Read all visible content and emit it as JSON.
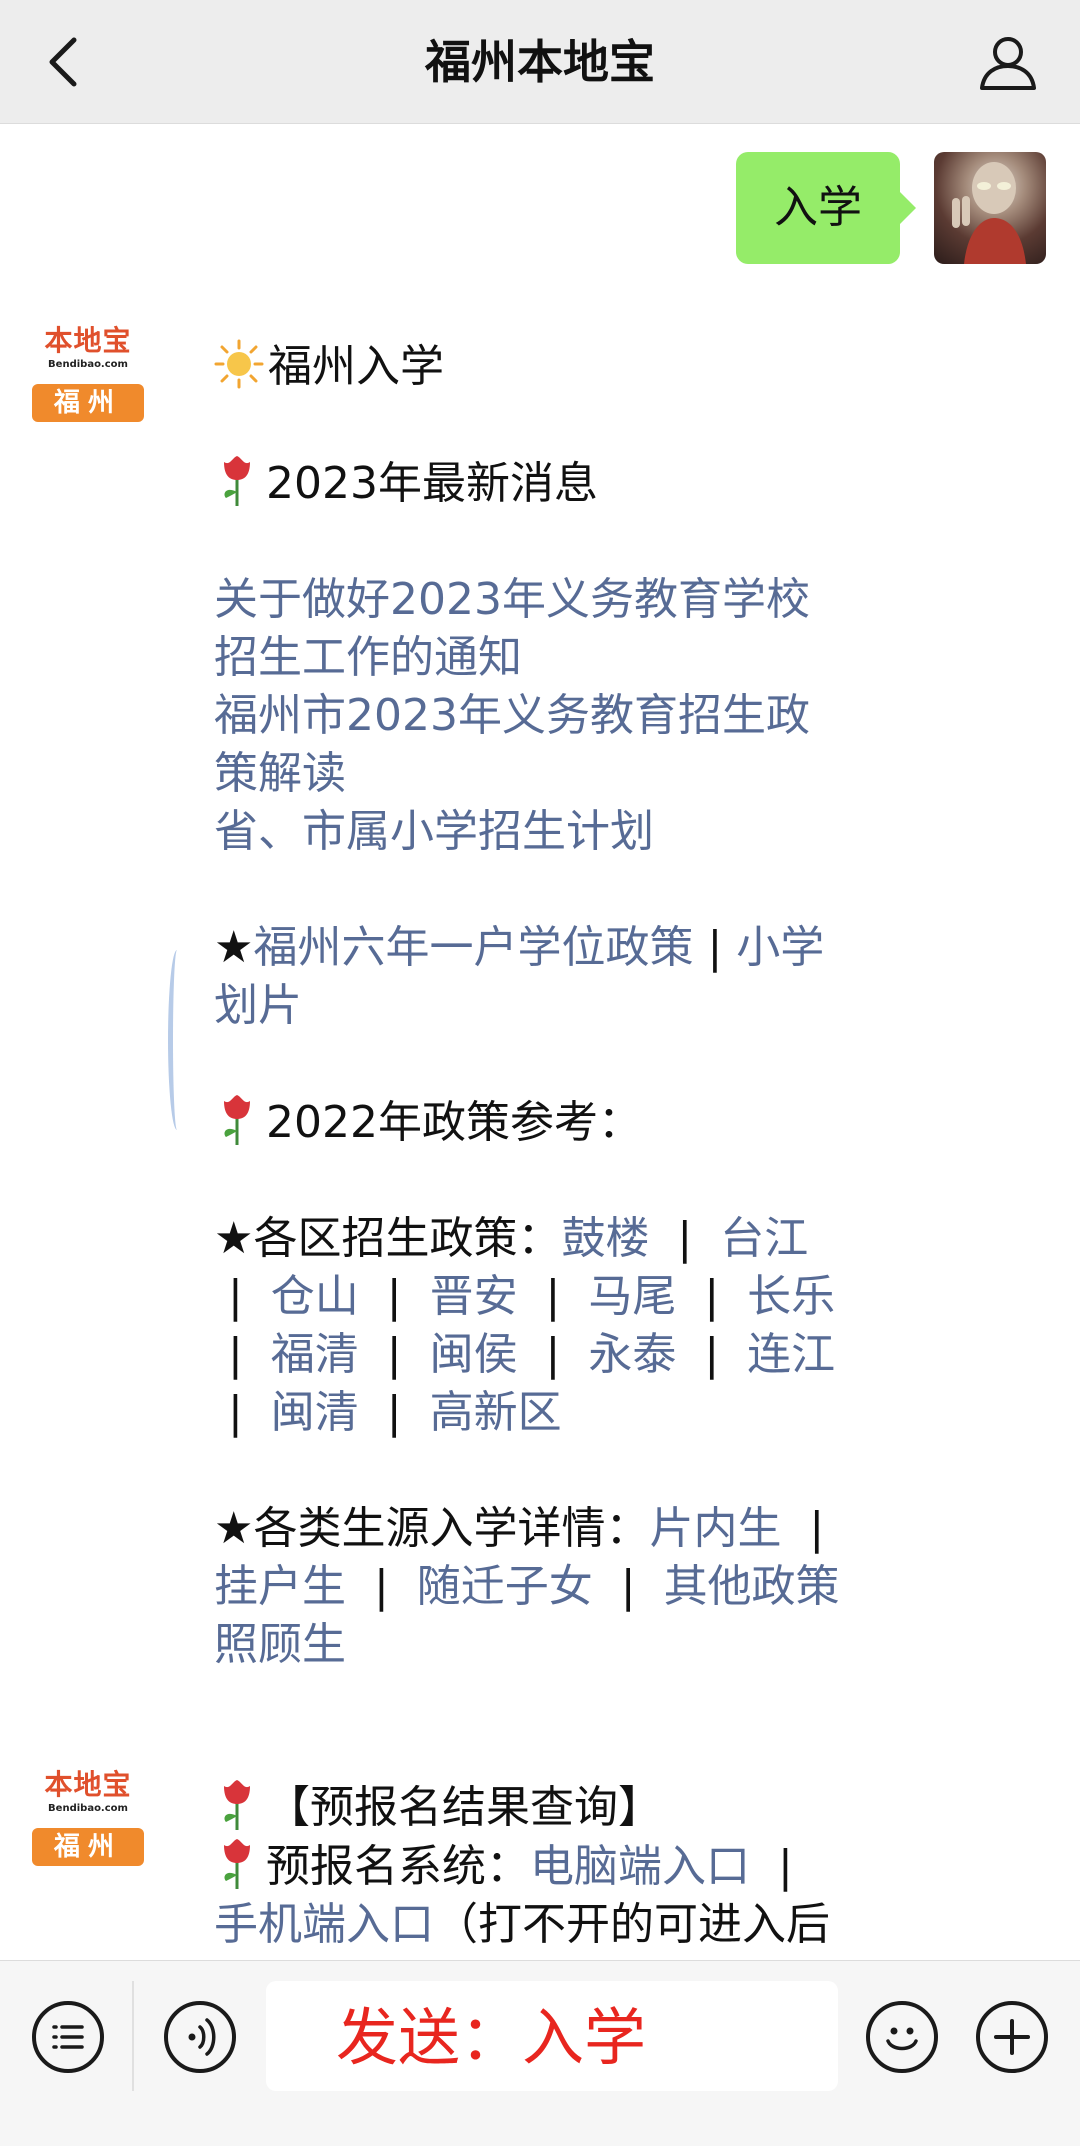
{
  "header": {
    "title": "福州本地宝"
  },
  "outgoing": {
    "text": "入学"
  },
  "official_account": {
    "brand": "本地宝",
    "site": "Bendibao.com",
    "city": "福州"
  },
  "message1": {
    "heading": "福州入学",
    "news_title": "2023年最新消息",
    "links": [
      "关于做好2023年义务教育学校",
      "招生工作的通知",
      "福州市2023年义务教育招生政",
      "策解读",
      "省、市属小学招生计划"
    ],
    "star_line": {
      "star": "★",
      "link1": "福州六年一户学位政策",
      "sep": " | ",
      "link2a": "小学",
      "link2b": "划片"
    },
    "ref_title": "2022年政策参考：",
    "district": {
      "label": "★各区招生政策：",
      "items": [
        "鼓楼",
        "台江",
        "仓山",
        "晋安",
        "马尾",
        "长乐",
        "福清",
        "闽侯",
        "永泰",
        "连江",
        "闽清",
        "高新区"
      ]
    },
    "source": {
      "label": "★各类生源入学详情：",
      "items": [
        "片内生",
        "挂户生",
        "随迁子女",
        "其他政策",
        "照顾生"
      ]
    }
  },
  "message2": {
    "line1": "【预报名结果查询】",
    "line2_prefix": "预报名系统：",
    "link_pc": "电脑端入口",
    "link_mobile": "手机端入口",
    "line3_suffix": "（打不开的可进入后"
  },
  "input": {
    "text": "发送：入学"
  },
  "icons": [
    "back-arrow-icon",
    "user-icon",
    "sun-emoji-icon",
    "rose-emoji-icon",
    "menu-list-icon",
    "voice-icon",
    "emoji-face-icon",
    "plus-icon"
  ],
  "colors": {
    "link": "#576b95",
    "out_bubble": "#95ec69",
    "input_text": "#e8261f",
    "brand_orange": "#f08a2c"
  }
}
